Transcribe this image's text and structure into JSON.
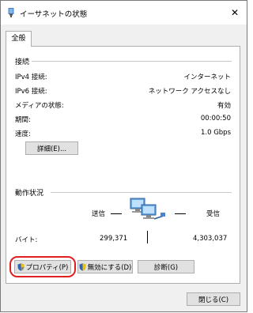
{
  "window": {
    "title": "イーサネットの状態",
    "close_icon": "✕"
  },
  "tabs": [
    {
      "label": "全般",
      "selected": true
    }
  ],
  "connection": {
    "group_title": "接続",
    "rows": [
      {
        "label": "IPv4 接続:",
        "value": "インターネット"
      },
      {
        "label": "IPv6 接続:",
        "value": "ネットワーク アクセスなし"
      },
      {
        "label": "メディアの状態:",
        "value": "有効"
      },
      {
        "label": "期間:",
        "value": "00:00:50"
      },
      {
        "label": "速度:",
        "value": "1.0 Gbps"
      }
    ],
    "details_button": "詳細(E)..."
  },
  "activity": {
    "group_title": "動作状況",
    "sent_label": "送信",
    "received_label": "受信",
    "bytes_label": "バイト:",
    "bytes_sent": "299,371",
    "bytes_received": "4,303,037"
  },
  "buttons": {
    "properties": "プロパティ(P)",
    "disable": "無効にする(D)",
    "diagnose": "診断(G)",
    "close": "閉じる(C)"
  },
  "colors": {
    "highlight": "#e02020",
    "shield_blue": "#2b63c6",
    "shield_yellow": "#f2c200"
  }
}
